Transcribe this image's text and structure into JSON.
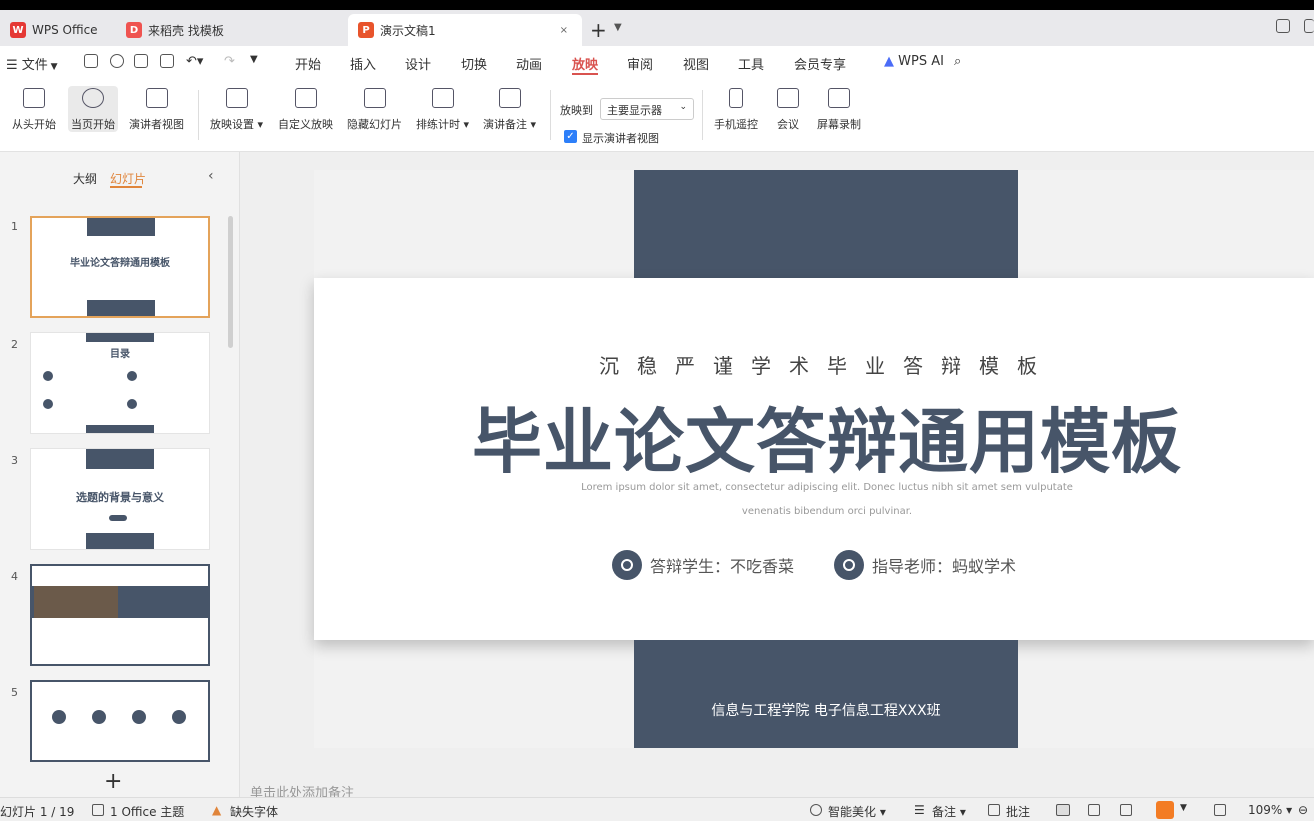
{
  "tabs": [
    {
      "label": "WPS Office",
      "icon": "wps-logo"
    },
    {
      "label": "来稻壳 找模板",
      "icon": "daoke-logo"
    },
    {
      "label": "演示文稿1",
      "icon": "presentation-logo"
    }
  ],
  "tab_close": "×",
  "tab_add": "+",
  "menu": {
    "file": "文件",
    "items": [
      "开始",
      "插入",
      "设计",
      "切换",
      "动画",
      "放映",
      "审阅",
      "视图",
      "工具",
      "会员专享"
    ],
    "active": "放映",
    "wps_ai": "WPS AI"
  },
  "ribbon": {
    "from_start": "从头开始",
    "from_current": "当页开始",
    "presenter_view": "演讲者视图",
    "show_settings": "放映设置",
    "custom_show": "自定义放映",
    "hide_slide": "隐藏幻灯片",
    "rehearse": "排练计时",
    "speaker_notes": "演讲备注",
    "show_to_label": "放映到",
    "show_to_value": "主要显示器",
    "show_presenter_view": "显示演讲者视图",
    "phone_remote": "手机遥控",
    "meeting": "会议",
    "screen_record": "屏幕录制"
  },
  "left_panel": {
    "tab_outline": "大纲",
    "tab_slides": "幻灯片",
    "slides": [
      {
        "num": "1",
        "title": "毕业论文答辩通用模板"
      },
      {
        "num": "2",
        "title": "目录"
      },
      {
        "num": "3",
        "title": "选题的背景与意义"
      },
      {
        "num": "4",
        "title": ""
      },
      {
        "num": "5",
        "title": ""
      }
    ]
  },
  "slide": {
    "subtitle": "沉稳严谨学术毕业答辩模板",
    "title": "毕业论文答辩通用模板",
    "lorem1": "Lorem ipsum dolor sit amet, consectetur adipiscing elit. Donec luctus nibh sit amet sem vulputate",
    "lorem2": "venenatis bibendum orci pulvinar.",
    "student": "答辩学生：不吃香菜",
    "teacher": "指导老师：蚂蚁学术",
    "footer": "信息与工程学院 电子信息工程XXX班"
  },
  "notes_placeholder": "单击此处添加备注",
  "status": {
    "slide_count": "幻灯片 1 / 19",
    "theme": "1 Office 主题",
    "missing_font": "缺失字体",
    "beautify": "智能美化",
    "notes": "备注",
    "comments": "批注",
    "zoom": "109%"
  },
  "colors": {
    "accent": "#475569",
    "active_menu": "#d9534f",
    "panel_active": "#e0853b"
  }
}
